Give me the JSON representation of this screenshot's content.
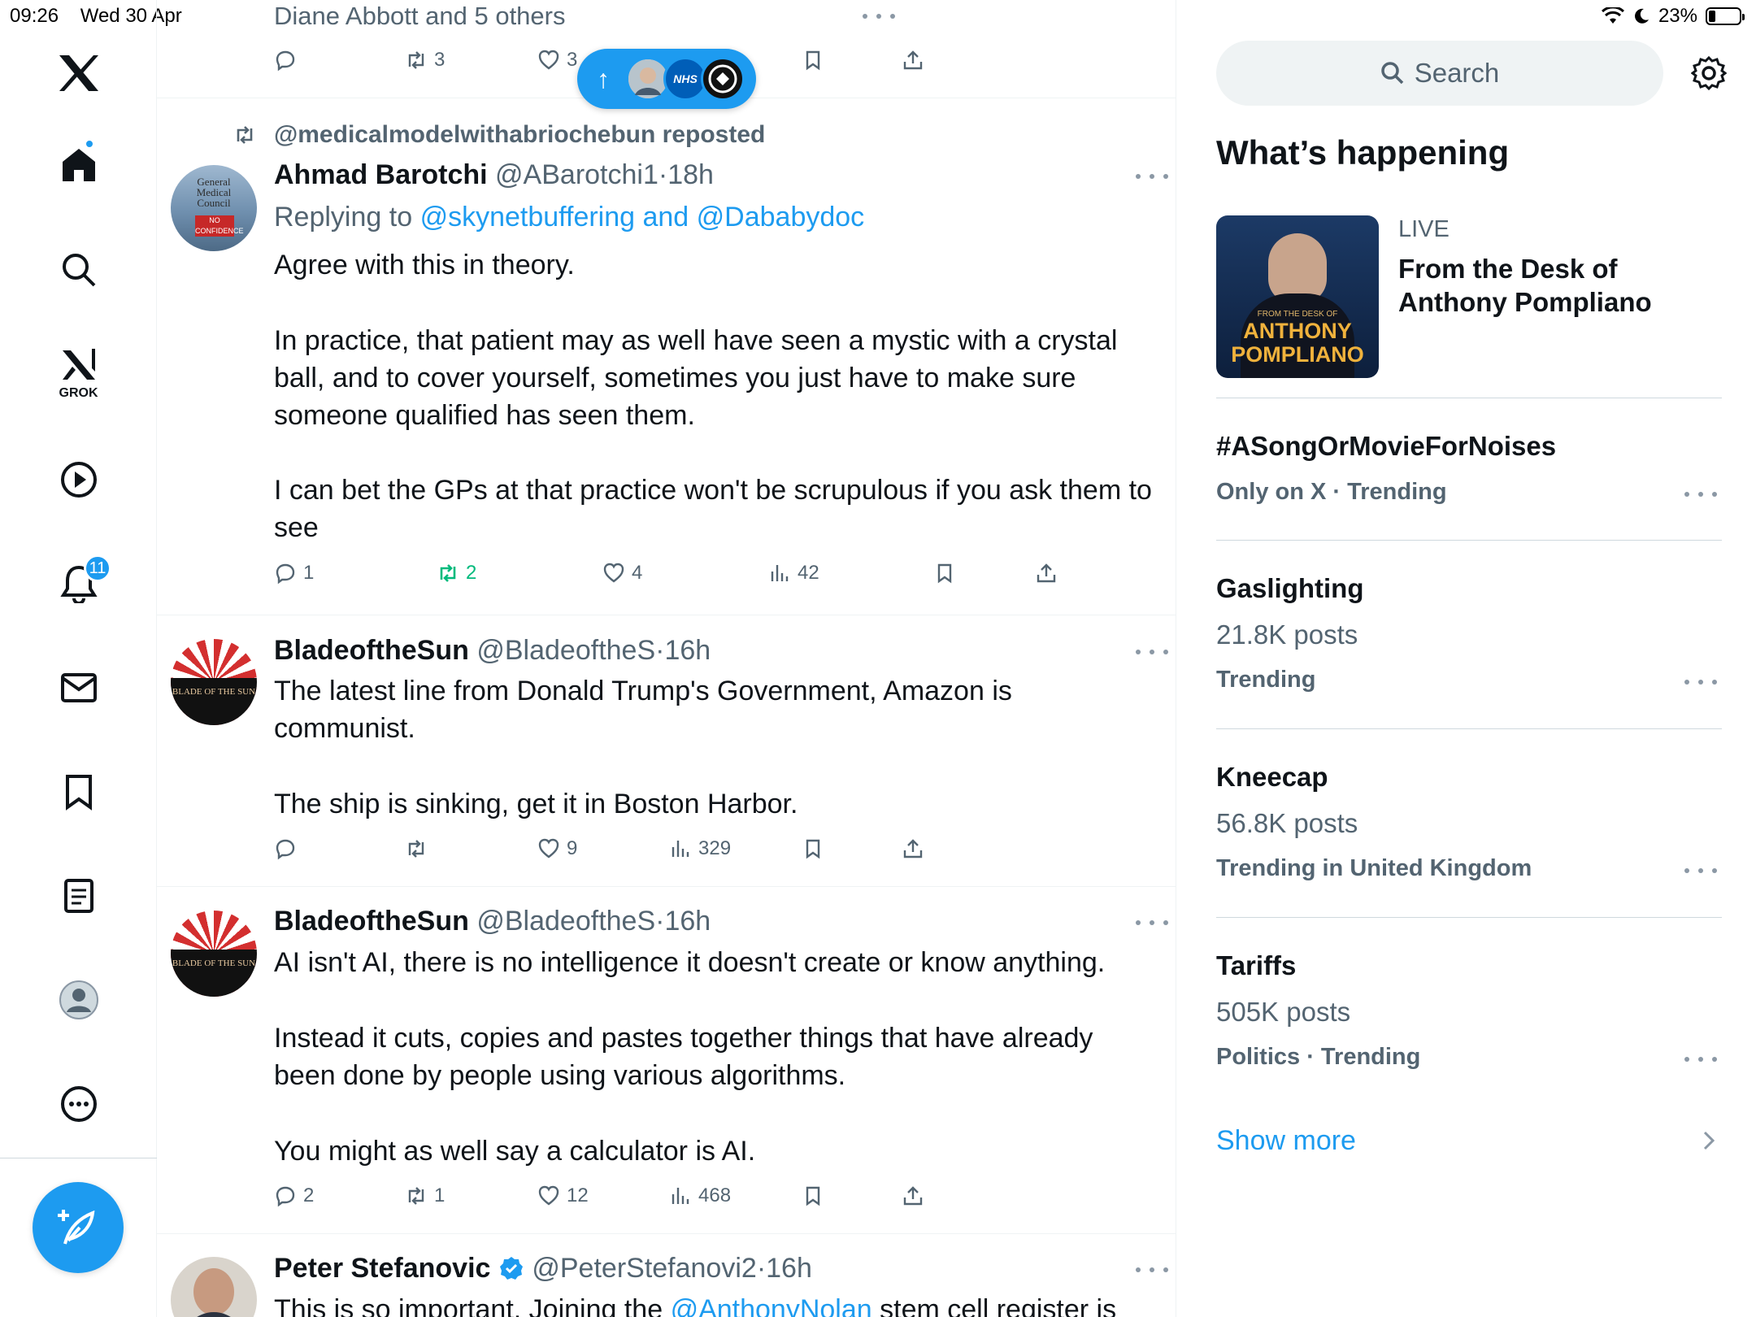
{
  "status": {
    "time": "09:26",
    "date": "Wed 30 Apr",
    "battery": "23%",
    "battery_level": 0.23
  },
  "nav": {
    "grok_label": "GROK",
    "notifications_count": "11"
  },
  "new_posts_pill": {
    "arrow": "↑",
    "avatar_text": "NHS"
  },
  "prev_post": {
    "liked_by": "Diane Abbott and 5 others",
    "retweets": "3",
    "likes": "3"
  },
  "posts": [
    {
      "repost_label": "@medicalmodelwithabriochebun reposted",
      "name": "Ahmad Barotchi",
      "handle": "@ABarotchi1",
      "dot": "·",
      "time": "18h",
      "replying_prefix": "Replying to",
      "replying_to": "@skynetbuffering and @Dababydoc",
      "avatar_text": "General Medical Council NO CONFIDENCE",
      "lines": [
        "Agree with this in theory.",
        "In practice, that patient may as well have seen a mystic with a crystal",
        "ball, and to cover yourself, sometimes you just have to make sure",
        "someone qualified has seen them.",
        "I can bet the GPs at that practice won't be scrupulous if you ask them to",
        "see"
      ],
      "replies": "1",
      "retweets": "2",
      "likes": "4",
      "views": "42"
    },
    {
      "name": "BladeoftheSun",
      "handle": "@BladeoftheS",
      "dot": "·",
      "time": "16h",
      "avatar_text": "BLADE OF THE SUN",
      "lines": [
        "The latest line from Donald Trump's Government, Amazon is",
        "communist.",
        "The ship is sinking, get it in Boston Harbor."
      ],
      "replies": "",
      "retweets": "",
      "likes": "9",
      "views": "329"
    },
    {
      "name": "BladeoftheSun",
      "handle": "@BladeoftheS",
      "dot": "·",
      "time": "16h",
      "avatar_text": "BLADE OF THE SUN",
      "lines": [
        "AI isn't AI, there is no intelligence it doesn't create or know anything.",
        "Instead it cuts, copies and pastes together things that have already",
        "been done by people using various algorithms.",
        "You might as well say a calculator is AI."
      ],
      "replies": "2",
      "retweets": "1",
      "likes": "12",
      "views": "468"
    },
    {
      "name": "Peter Stefanovic",
      "handle": "@PeterStefanovi2",
      "dot": "·",
      "time": "16h",
      "text_before": "This is so important. Joining the",
      "mention": "@AnthonyNolan",
      "text_after": "stem cell register is"
    }
  ],
  "sidebar": {
    "search_placeholder": "Search",
    "heading": "What’s happening",
    "live": {
      "label": "LIVE",
      "title_line1": "From the Desk of",
      "title_line2": "Anthony Pompliano",
      "thumb_small": "FROM THE DESK OF",
      "thumb_name1": "ANTHONY",
      "thumb_name2": "POMPLIANO"
    },
    "trends": [
      {
        "title": "#ASongOrMovieForNoises",
        "meta": "Only on X · Trending",
        "count": ""
      },
      {
        "title": "Gaslighting",
        "count": "21.8K posts",
        "meta": "Trending"
      },
      {
        "title": "Kneecap",
        "count": "56.8K posts",
        "meta": "Trending in United Kingdom"
      },
      {
        "title": "Tariffs",
        "count": "505K posts",
        "meta": "Politics · Trending"
      }
    ],
    "show_more": "Show more"
  },
  "colors": {
    "accent": "#1d9bf0",
    "muted": "#536471",
    "retweet_active": "#00ba7c"
  }
}
